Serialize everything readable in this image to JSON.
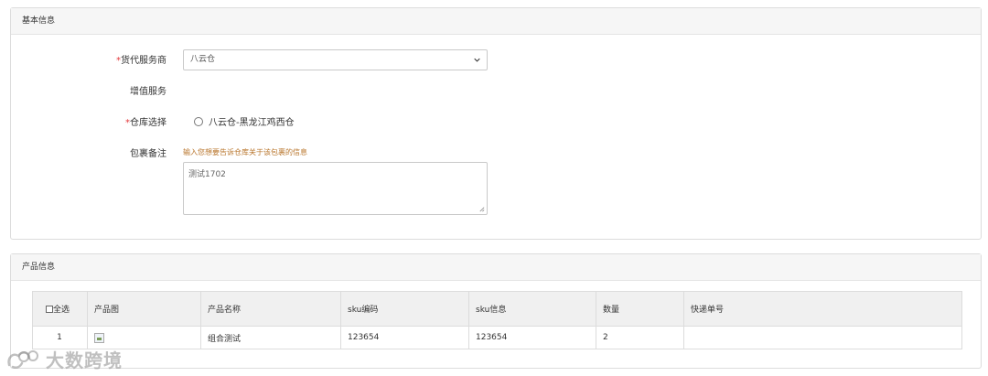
{
  "basic_info": {
    "title": "基本信息",
    "forwarder": {
      "required_mark": "*",
      "label": "货代服务商",
      "selected": "八云仓"
    },
    "value_added": {
      "label": "增值服务"
    },
    "warehouse": {
      "required_mark": "*",
      "label": "仓库选择",
      "option": "八云仓-黑龙江鸡西仓"
    },
    "remark": {
      "label": "包裹备注",
      "hint": "输入您想要告诉仓库关于该包裹的信息",
      "value": "测试1702"
    }
  },
  "product_info": {
    "title": "产品信息",
    "select_all": "全选",
    "columns": [
      "产品图",
      "产品名称",
      "sku编码",
      "sku信息",
      "数量",
      "快递单号"
    ],
    "rows": [
      {
        "index": "1",
        "name": "组合测试",
        "sku_code": "123654",
        "sku_info": "123654",
        "qty": "2",
        "tracking": ""
      }
    ]
  },
  "watermark": {
    "text": "大数跨境"
  },
  "colors": {
    "required": "#e4393c",
    "hint": "#b8742a",
    "panel_header": "#f6f6f6",
    "border": "#dcdcdc"
  }
}
